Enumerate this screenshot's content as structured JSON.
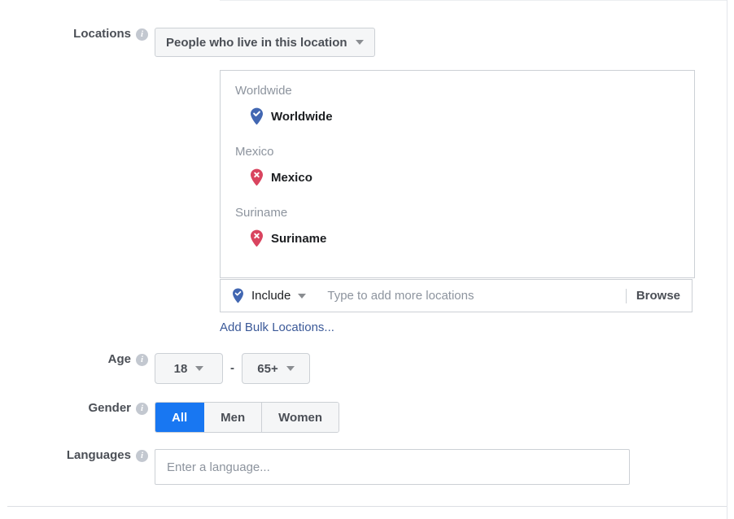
{
  "form": {
    "locations": {
      "label": "Locations",
      "info_icon": "info-icon",
      "audience_select": {
        "value": "People who live in this location",
        "caret_icon": "chevron-down-icon"
      },
      "groups": [
        {
          "header": "Worldwide",
          "items": [
            {
              "name": "Worldwide",
              "pin_icon": "map-pin-check-icon",
              "mode": "include"
            }
          ]
        },
        {
          "header": "Mexico",
          "items": [
            {
              "name": "Mexico",
              "pin_icon": "map-pin-exclude-icon",
              "mode": "exclude"
            }
          ]
        },
        {
          "header": "Suriname",
          "items": [
            {
              "name": "Suriname",
              "pin_icon": "map-pin-exclude-icon",
              "mode": "exclude"
            }
          ]
        }
      ],
      "include_bar": {
        "mode_label": "Include",
        "mode_pin_icon": "map-pin-check-icon",
        "caret_icon": "chevron-down-icon",
        "search_value": "",
        "search_placeholder": "Type to add more locations",
        "browse_label": "Browse"
      },
      "bulk_link": "Add Bulk Locations..."
    },
    "age": {
      "label": "Age",
      "info_icon": "info-icon",
      "min": "18",
      "separator": "-",
      "max": "65+",
      "caret_icon": "chevron-down-icon"
    },
    "gender": {
      "label": "Gender",
      "info_icon": "info-icon",
      "options": [
        {
          "label": "All",
          "selected": true
        },
        {
          "label": "Men",
          "selected": false
        },
        {
          "label": "Women",
          "selected": false
        }
      ]
    },
    "languages": {
      "label": "Languages",
      "info_icon": "info-icon",
      "value": "",
      "placeholder": "Enter a language..."
    }
  },
  "colors": {
    "accent_blue": "#1877f2",
    "link_blue": "#3b5998",
    "pin_include": "#4267b2",
    "pin_exclude": "#d9445f",
    "border": "#ccd0d5",
    "muted_text": "#8d949e",
    "label_text": "#4b4f56"
  },
  "info_glyph": "i"
}
